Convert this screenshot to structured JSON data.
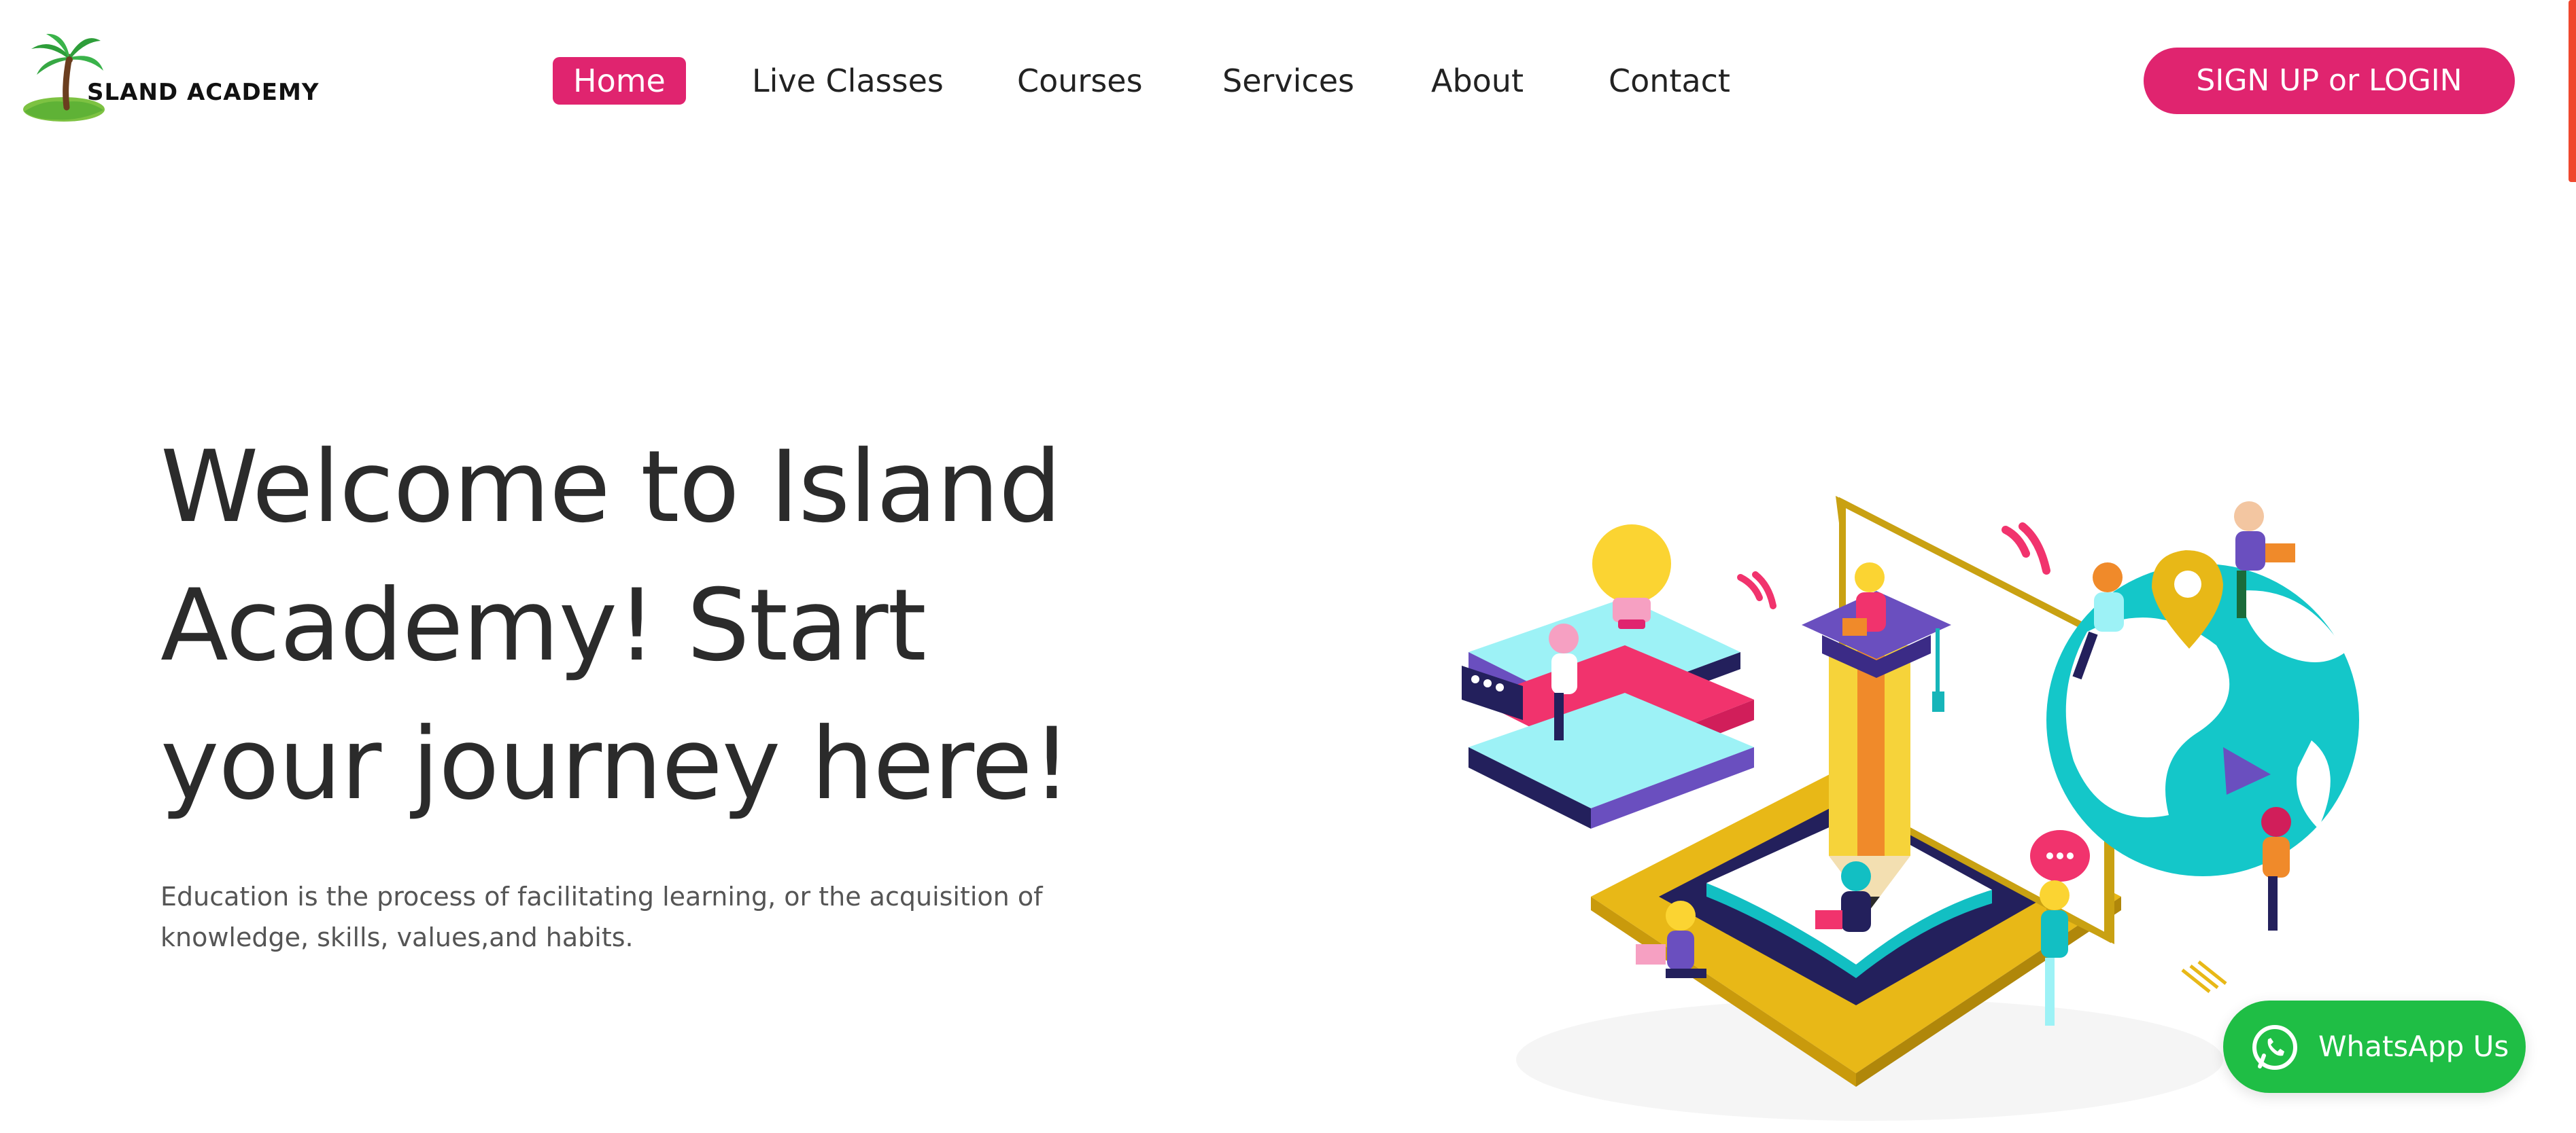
{
  "header": {
    "logo_text": "SLAND ACADEMY",
    "nav": [
      {
        "label": "Home",
        "active": true
      },
      {
        "label": "Live Classes",
        "active": false
      },
      {
        "label": "Courses",
        "active": false
      },
      {
        "label": "Services",
        "active": false
      },
      {
        "label": "About",
        "active": false
      },
      {
        "label": "Contact",
        "active": false
      }
    ],
    "signup_label": "SIGN UP or LOGIN"
  },
  "hero": {
    "title_lines": [
      "Welcome to Island",
      "Academy! Start",
      "your journey here!"
    ],
    "description_lines": [
      "Education is the process of facilitating learning, or the acquisition of",
      "knowledge, skills, values,and habits."
    ]
  },
  "whatsapp": {
    "label": "WhatsApp Us",
    "icon": "whatsapp-icon"
  },
  "colors": {
    "accent": "#e0246f",
    "whatsapp_green": "#1fbe45",
    "scroll_indicator": "#f0482e",
    "heading_text": "#2b2b2b",
    "body_text": "#555555"
  },
  "icons": {
    "logo": "palm-tree-island-icon",
    "illustration": "education-isometric-illustration"
  }
}
